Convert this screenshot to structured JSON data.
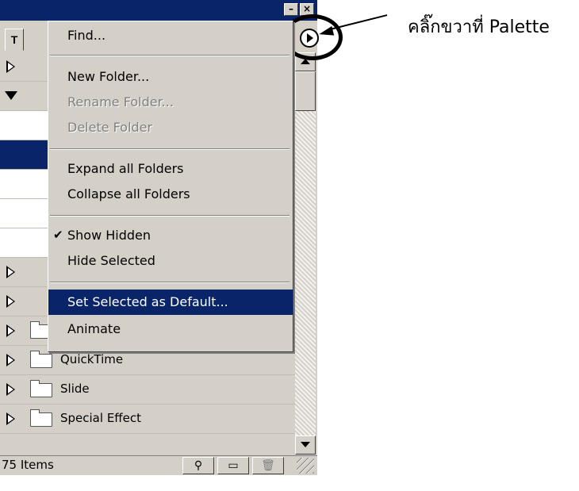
{
  "menu": {
    "items": [
      {
        "label": "Find...",
        "enabled": true
      },
      {
        "label": "New Folder...",
        "enabled": true
      },
      {
        "label": "Rename Folder...",
        "enabled": false
      },
      {
        "label": "Delete Folder",
        "enabled": false
      },
      {
        "label": "Expand all Folders",
        "enabled": true
      },
      {
        "label": "Collapse all Folders",
        "enabled": true
      },
      {
        "label": "Show Hidden",
        "enabled": true,
        "checked": true
      },
      {
        "label": "Hide Selected",
        "enabled": true
      },
      {
        "label": "Set Selected as Default...",
        "enabled": true,
        "highlighted": true
      },
      {
        "label": "Animate",
        "enabled": true
      }
    ]
  },
  "palette": {
    "tab_label": "T",
    "folders": [
      "QuickTime",
      "Slide",
      "Special Effect"
    ],
    "status_count": "75 Items"
  },
  "annotation": {
    "text": "คลิ๊กขวาที่ Palette"
  },
  "colors": {
    "highlight": "#0a246a",
    "face": "#d4d0c8"
  }
}
